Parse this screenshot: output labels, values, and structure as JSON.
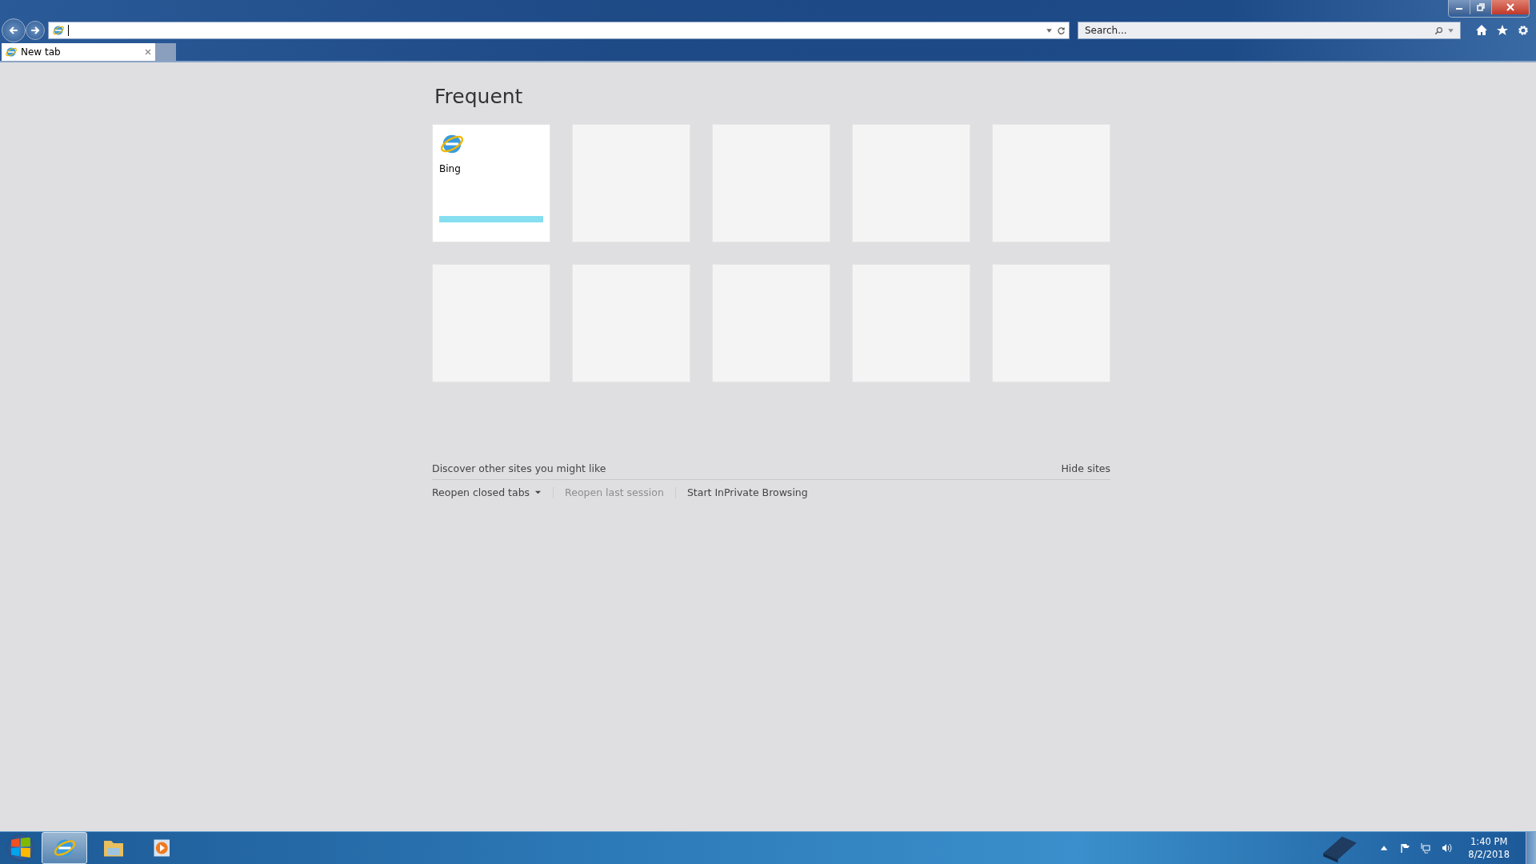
{
  "search": {
    "placeholder": "Search..."
  },
  "tabs": [
    {
      "label": "New tab",
      "selected": true
    }
  ],
  "heading": "Frequent",
  "tiles": [
    {
      "kind": "site",
      "title": "Bing",
      "level": 1
    },
    {
      "kind": "empty"
    },
    {
      "kind": "empty"
    },
    {
      "kind": "empty"
    },
    {
      "kind": "empty"
    },
    {
      "kind": "empty"
    },
    {
      "kind": "empty"
    },
    {
      "kind": "empty"
    },
    {
      "kind": "empty"
    },
    {
      "kind": "empty"
    }
  ],
  "discover": {
    "text": "Discover other sites you might like",
    "hide": "Hide sites"
  },
  "actions": [
    {
      "label": "Reopen closed tabs",
      "dropdown": true,
      "disabled": false
    },
    {
      "label": "Reopen last session",
      "dropdown": false,
      "disabled": true
    },
    {
      "label": "Start InPrivate Browsing",
      "dropdown": false,
      "disabled": false
    }
  ],
  "taskbar": {
    "apps": [
      {
        "kind": "ie",
        "selected": true
      },
      {
        "kind": "folder",
        "selected": false
      },
      {
        "kind": "media",
        "selected": false
      }
    ],
    "time": "1:40 PM",
    "date": "8/2/2018"
  }
}
